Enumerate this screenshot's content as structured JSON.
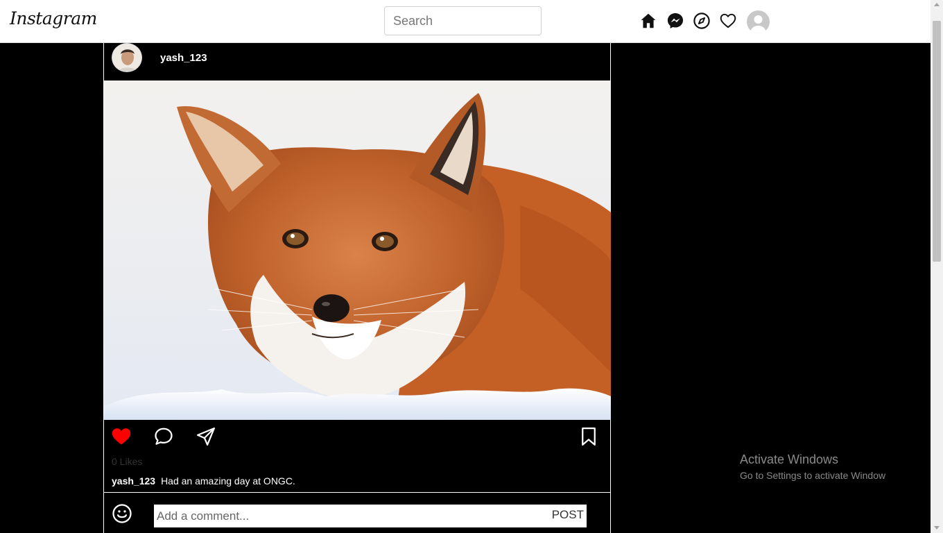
{
  "nav": {
    "logo": "Instagram",
    "search_placeholder": "Search",
    "icons": [
      "home-icon",
      "messenger-icon",
      "explore-icon",
      "heart-icon",
      "profile-avatar"
    ]
  },
  "post": {
    "username": "yash_123",
    "image_subject": "red fox in snow",
    "liked": true,
    "likes_text": "0 Likes",
    "caption_user": "yash_123",
    "caption_text": "Had an amazing day at ONGC.",
    "comment_placeholder": "Add a comment...",
    "post_button": "POST"
  },
  "watermark": {
    "title": "Activate Windows",
    "subtitle": "Go to Settings to activate Window"
  },
  "colors": {
    "like_red": "#ff0000",
    "background": "#000000",
    "topbar": "#ffffff"
  }
}
